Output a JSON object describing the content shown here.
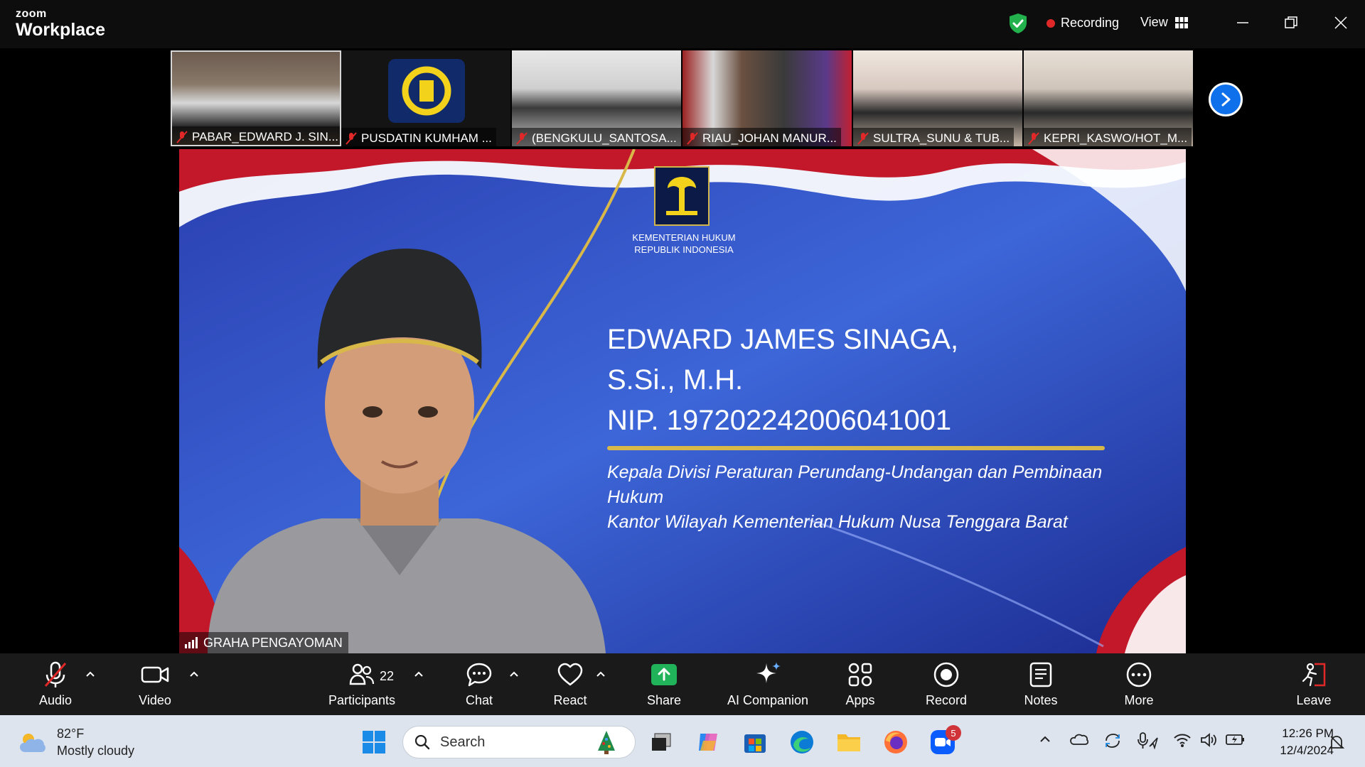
{
  "app": {
    "brand_small": "zoom",
    "brand_large": "Workplace"
  },
  "header": {
    "recording_label": "Recording",
    "view_label": "View"
  },
  "thumbnails": [
    {
      "name": "PABAR_EDWARD J. SIN..."
    },
    {
      "name": "PUSDATIN KUMHAM ..."
    },
    {
      "name": "(BENGKULU_SANTOSA..."
    },
    {
      "name": "RIAU_JOHAN MANUR..."
    },
    {
      "name": "SULTRA_SUNU & TUB..."
    },
    {
      "name": "KEPRI_KASWO/HOT_M..."
    }
  ],
  "main_video": {
    "label": "GRAHA PENGAYOMAN",
    "logo_text_1": "KEMENTERIAN HUKUM",
    "logo_text_2": "REPUBLIK INDONESIA",
    "name_line_1": "EDWARD JAMES SINAGA,",
    "name_line_2": "S.Si., M.H.",
    "name_line_3": "NIP. 197202242006041001",
    "desc_line_1": "Kepala Divisi Peraturan Perundang-Undangan dan Pembinaan",
    "desc_line_2": "Hukum",
    "desc_line_3": "Kantor Wilayah Kementerian Hukum Nusa Tenggara Barat"
  },
  "toolbar": {
    "audio": "Audio",
    "video": "Video",
    "participants": "Participants",
    "participants_count": "22",
    "chat": "Chat",
    "react": "React",
    "share": "Share",
    "ai_companion": "AI Companion",
    "apps": "Apps",
    "record": "Record",
    "notes": "Notes",
    "more": "More",
    "leave": "Leave"
  },
  "taskbar": {
    "weather_temp": "82°F",
    "weather_desc": "Mostly cloudy",
    "search_placeholder": "Search",
    "zoom_badge": "5",
    "time": "12:26 PM",
    "date": "12/4/2024"
  },
  "colors": {
    "accent_blue": "#0e71eb",
    "recording_red": "#e02828",
    "share_green": "#21b35a",
    "leave_red": "#e02828"
  }
}
